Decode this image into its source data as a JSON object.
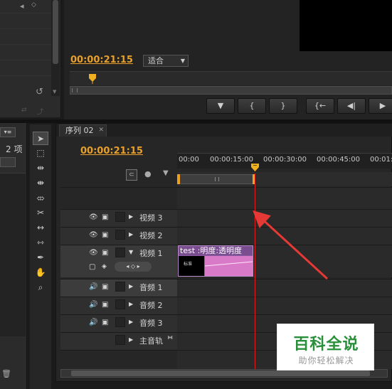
{
  "program_monitor": {
    "timecode": "00:00:21:15",
    "fit_dropdown": "适合",
    "transport_buttons": [
      "mark-in",
      "mark-in-bracket",
      "mark-out-bracket",
      "go-to-in",
      "step-back",
      "play"
    ]
  },
  "project_panel": {
    "item_count": "2 项"
  },
  "timeline": {
    "tab_label": "序列 02",
    "timecode": "00:00:21:15",
    "ruler_ticks": [
      "00:00",
      "00:00:15:00",
      "00:00:30:00",
      "00:00:45:00",
      "00:01:"
    ],
    "tracks": {
      "v3": "视频 3",
      "v2": "视频 2",
      "v1": "视频 1",
      "a1": "音频 1",
      "a2": "音频 2",
      "a3": "音频 3",
      "master": "主音轨"
    },
    "clip": {
      "label": "test :明度:透明度",
      "thumb_text": "标准"
    }
  },
  "watermark": {
    "title": "百科全说",
    "subtitle": "助你轻松解决"
  },
  "colors": {
    "timecode": "#e8a02b",
    "playhead": "#e02020",
    "clip": "#8a5aa0",
    "opacity_band": "#d97ac8",
    "arrow": "#e53935",
    "watermark_green": "#2a8f3a"
  }
}
